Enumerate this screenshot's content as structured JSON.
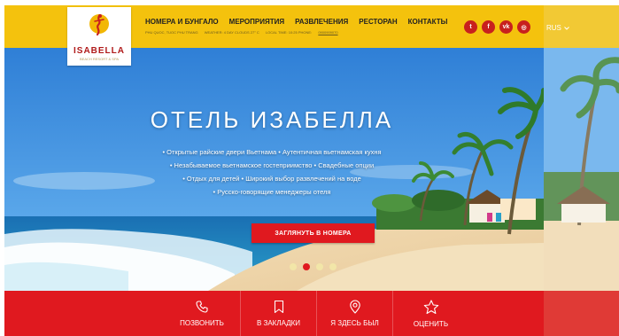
{
  "brand": {
    "name": "ISABELLA",
    "tagline": "BEACH RESORT & SPA"
  },
  "nav": {
    "items": [
      "НОМЕРА И БУНГАЛО",
      "МЕРОПРИЯТИЯ",
      "РАЗВЛЕЧЕНИЯ",
      "РЕСТОРАН",
      "КОНТАКТЫ"
    ]
  },
  "subinfo": {
    "location": "PHU QUOC, TUOC PHU TRANG",
    "weather": "WEATHER: 4 DAY CLOUDS 27° C",
    "time": "LOCAL TIME: 10:25 PHONE:",
    "phone": "0900909070"
  },
  "socials": [
    {
      "icon": "twitter-icon",
      "glyph": "t"
    },
    {
      "icon": "facebook-icon",
      "glyph": "f"
    },
    {
      "icon": "vk-icon",
      "glyph": "vk"
    },
    {
      "icon": "instagram-icon",
      "glyph": "◎"
    }
  ],
  "lang": {
    "current": "RUS"
  },
  "hero": {
    "title": "ОТЕЛЬ ИЗАБЕЛЛА",
    "features": [
      "• Открытые райские двери Вьетнама • Аутентичная вьетнамская кухня",
      "• Незабываемое вьетнамское гостеприимство • Свадебные опции",
      "• Отдых для детей • Широкий выбор развлечений на воде",
      "• Русско-говорящие менеджеры отеля"
    ],
    "cta": "ЗАГЛЯНУТЬ В НОМЕРА",
    "slides": 4,
    "active_slide": 2
  },
  "actions": [
    {
      "label": "ПОЗВОНИТЬ",
      "icon": "phone-icon"
    },
    {
      "label": "В ЗАКЛАДКИ",
      "icon": "bookmark-icon"
    },
    {
      "label": "Я ЗДЕСЬ БЫЛ",
      "icon": "map-pin-icon"
    },
    {
      "label": "ОЦЕНИТЬ",
      "icon": "star-icon"
    }
  ],
  "colors": {
    "header": "#f4c20d",
    "accent": "#e0191f",
    "sky": "#3f8fdd"
  }
}
